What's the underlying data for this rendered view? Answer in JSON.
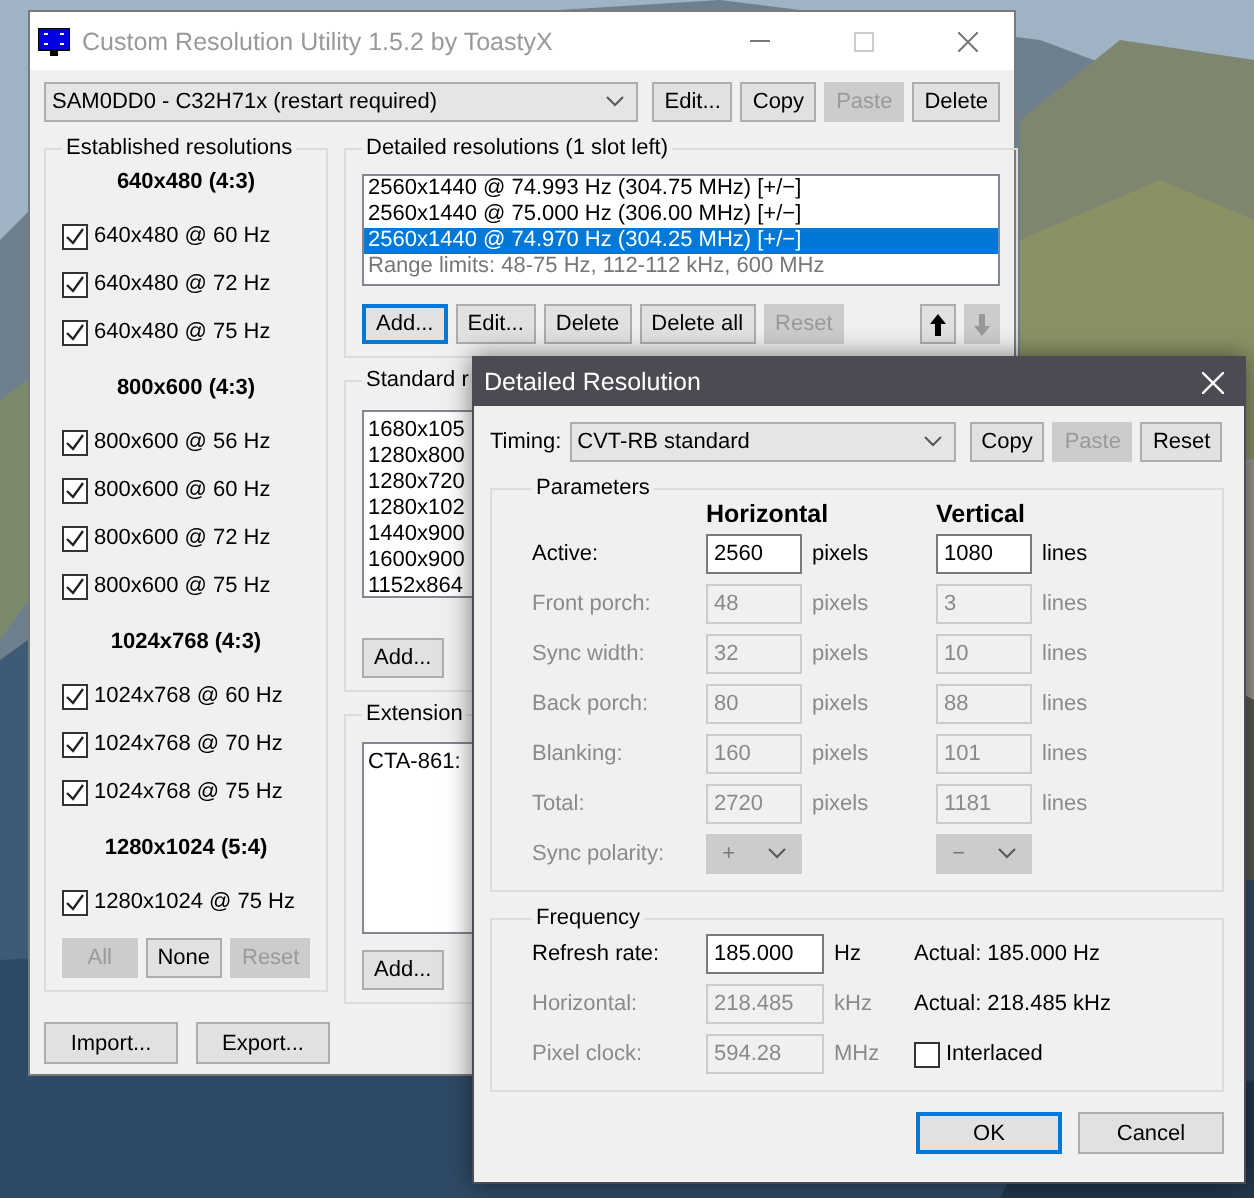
{
  "main_window": {
    "title": "Custom Resolution Utility 1.5.2 by ToastyX",
    "device": "SAM0DD0 - C32H71x (restart required)",
    "device_buttons": [
      {
        "label": "Edit...",
        "disabled": false
      },
      {
        "label": "Copy",
        "disabled": false
      },
      {
        "label": "Paste",
        "disabled": true
      },
      {
        "label": "Delete",
        "disabled": false
      }
    ],
    "established": {
      "title": "Established resolutions",
      "groups": [
        {
          "heading": "640x480 (4:3)",
          "items": [
            {
              "label": "640x480 @ 60 Hz",
              "checked": true
            },
            {
              "label": "640x480 @ 72 Hz",
              "checked": true
            },
            {
              "label": "640x480 @ 75 Hz",
              "checked": true
            }
          ]
        },
        {
          "heading": "800x600 (4:3)",
          "items": [
            {
              "label": "800x600 @ 56 Hz",
              "checked": true
            },
            {
              "label": "800x600 @ 60 Hz",
              "checked": true
            },
            {
              "label": "800x600 @ 72 Hz",
              "checked": true
            },
            {
              "label": "800x600 @ 75 Hz",
              "checked": true
            }
          ]
        },
        {
          "heading": "1024x768 (4:3)",
          "items": [
            {
              "label": "1024x768 @ 60 Hz",
              "checked": true
            },
            {
              "label": "1024x768 @ 70 Hz",
              "checked": true
            },
            {
              "label": "1024x768 @ 75 Hz",
              "checked": true
            }
          ]
        },
        {
          "heading": "1280x1024 (5:4)",
          "items": [
            {
              "label": "1280x1024 @ 75 Hz",
              "checked": true
            }
          ]
        }
      ],
      "buttons": [
        {
          "label": "All",
          "disabled": true
        },
        {
          "label": "None",
          "disabled": false
        },
        {
          "label": "Reset",
          "disabled": true
        }
      ]
    },
    "detailed": {
      "title": "Detailed resolutions (1 slot left)",
      "rows": [
        {
          "text": "2560x1440 @ 74.993 Hz (304.75 MHz) [+/−]",
          "kind": "entry",
          "selected": false
        },
        {
          "text": "2560x1440 @ 75.000 Hz (306.00 MHz) [+/−]",
          "kind": "entry",
          "selected": false
        },
        {
          "text": "2560x1440 @ 74.970 Hz (304.25 MHz) [+/−]",
          "kind": "entry",
          "selected": true
        },
        {
          "text": "Range limits: 48-75 Hz, 112-112 kHz, 600 MHz",
          "kind": "info",
          "selected": false
        }
      ],
      "buttons": [
        {
          "label": "Add...",
          "disabled": false,
          "focused": true
        },
        {
          "label": "Edit...",
          "disabled": false,
          "focused": false
        },
        {
          "label": "Delete",
          "disabled": false,
          "focused": false
        },
        {
          "label": "Delete all",
          "disabled": false,
          "focused": false
        },
        {
          "label": "Reset",
          "disabled": true,
          "focused": false
        }
      ],
      "move_buttons": [
        {
          "kind": "up",
          "disabled": false
        },
        {
          "kind": "down",
          "disabled": true
        }
      ]
    },
    "standard": {
      "title": "Standard r",
      "items": [
        "1680x105",
        "1280x800",
        "1280x720",
        "1280x102",
        "1440x900",
        "1600x900",
        "1152x864"
      ],
      "buttons": [
        {
          "label": "Add...",
          "disabled": false
        }
      ]
    },
    "extension": {
      "title": "Extension",
      "items": [
        "CTA-861:"
      ],
      "buttons": [
        {
          "label": "Add...",
          "disabled": false
        }
      ]
    },
    "footer_buttons": [
      "Import...",
      "Export..."
    ]
  },
  "dialog": {
    "title": "Detailed Resolution",
    "timing": {
      "label": "Timing:",
      "value": "CVT-RB standard"
    },
    "timing_buttons": [
      {
        "label": "Copy",
        "disabled": false
      },
      {
        "label": "Paste",
        "disabled": true
      },
      {
        "label": "Reset",
        "disabled": false
      }
    ],
    "parameters": {
      "title": "Parameters",
      "columns": [
        "Horizontal",
        "Vertical"
      ],
      "rows": [
        {
          "label": "Active:",
          "kind": "field",
          "disabled": false,
          "h_value": "2560",
          "h_unit": "pixels",
          "v_value": "1080",
          "v_unit": "lines"
        },
        {
          "label": "Front porch:",
          "kind": "field",
          "disabled": true,
          "h_value": "48",
          "h_unit": "pixels",
          "v_value": "3",
          "v_unit": "lines"
        },
        {
          "label": "Sync width:",
          "kind": "field",
          "disabled": true,
          "h_value": "32",
          "h_unit": "pixels",
          "v_value": "10",
          "v_unit": "lines"
        },
        {
          "label": "Back porch:",
          "kind": "field",
          "disabled": true,
          "h_value": "80",
          "h_unit": "pixels",
          "v_value": "88",
          "v_unit": "lines"
        },
        {
          "label": "Blanking:",
          "kind": "field",
          "disabled": true,
          "h_value": "160",
          "h_unit": "pixels",
          "v_value": "101",
          "v_unit": "lines"
        },
        {
          "label": "Total:",
          "kind": "field",
          "disabled": true,
          "h_value": "2720",
          "h_unit": "pixels",
          "v_value": "1181",
          "v_unit": "lines"
        },
        {
          "label": "Sync polarity:",
          "kind": "select",
          "disabled": true,
          "h_value": "+",
          "v_value": "−"
        }
      ]
    },
    "frequency": {
      "title": "Frequency",
      "rows": [
        {
          "label": "Refresh rate:",
          "disabled": false,
          "value": "185.000",
          "unit": "Hz",
          "extra": {
            "kind": "text",
            "text": "Actual: 185.000 Hz"
          }
        },
        {
          "label": "Horizontal:",
          "disabled": true,
          "value": "218.485",
          "unit": "kHz",
          "extra": {
            "kind": "text",
            "text": "Actual: 218.485 kHz"
          }
        },
        {
          "label": "Pixel clock:",
          "disabled": true,
          "value": "594.28",
          "unit": "MHz",
          "extra": {
            "kind": "checkbox",
            "text": "Interlaced",
            "checked": false
          }
        }
      ]
    },
    "buttons": [
      {
        "label": "OK",
        "default": true
      },
      {
        "label": "Cancel",
        "default": false
      }
    ]
  }
}
